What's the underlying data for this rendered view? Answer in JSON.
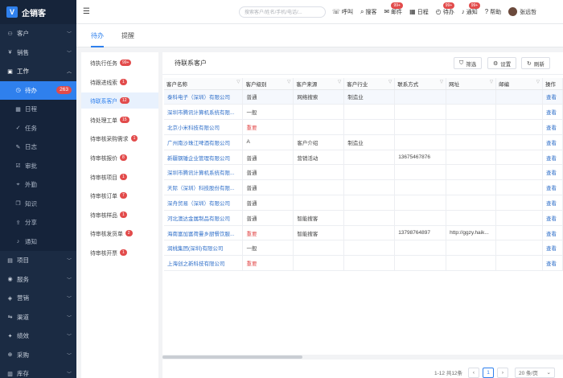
{
  "app": {
    "name": "企销客"
  },
  "sidebar": {
    "groups_top": [
      {
        "label": "客户",
        "icon": "users-icon"
      },
      {
        "label": "销售",
        "icon": "sales-icon"
      }
    ],
    "work_group": {
      "label": "工作",
      "icon": "work-icon"
    },
    "work_items": [
      {
        "label": "待办",
        "icon": "todo-icon",
        "count": "263"
      },
      {
        "label": "日程",
        "icon": "calendar-icon"
      },
      {
        "label": "任务",
        "icon": "task-icon"
      },
      {
        "label": "日志",
        "icon": "log-icon"
      },
      {
        "label": "审批",
        "icon": "approval-icon"
      },
      {
        "label": "外勤",
        "icon": "field-icon"
      },
      {
        "label": "知识",
        "icon": "knowledge-icon"
      },
      {
        "label": "分享",
        "icon": "share-icon"
      },
      {
        "label": "通知",
        "icon": "bell-icon"
      }
    ],
    "groups_bottom": [
      {
        "label": "项目",
        "icon": "project-icon"
      },
      {
        "label": "服务",
        "icon": "service-icon"
      },
      {
        "label": "营销",
        "icon": "marketing-icon"
      },
      {
        "label": "渠道",
        "icon": "channel-icon"
      },
      {
        "label": "绩效",
        "icon": "performance-icon"
      },
      {
        "label": "采购",
        "icon": "purchase-icon"
      },
      {
        "label": "库存",
        "icon": "inventory-icon"
      }
    ]
  },
  "topbar": {
    "search_placeholder": "搜索客户/姓名/手机/电话/...",
    "tools": [
      {
        "label": "呼叫",
        "icon": "phone-icon",
        "badge": ""
      },
      {
        "label": "搜客",
        "icon": "search-customer-icon",
        "badge": ""
      },
      {
        "label": "邮件",
        "icon": "mail-icon",
        "badge": "99+"
      },
      {
        "label": "日程",
        "icon": "calendar-icon",
        "badge": ""
      },
      {
        "label": "待办",
        "icon": "clock-icon",
        "badge": "99+"
      },
      {
        "label": "通知",
        "icon": "bell-icon",
        "badge": "99+"
      },
      {
        "label": "帮助",
        "icon": "help-icon",
        "badge": ""
      }
    ],
    "user_name": "张远哲"
  },
  "tabs": [
    {
      "label": "待办"
    },
    {
      "label": "提醒"
    }
  ],
  "left_list": [
    {
      "label": "待执行任务",
      "badge": "99+"
    },
    {
      "label": "待跟进线索",
      "badge": "1"
    },
    {
      "label": "待联系客户",
      "badge": "12"
    },
    {
      "label": "待处理工单",
      "badge": "15"
    },
    {
      "label": "待审核采购需求",
      "badge": "1"
    },
    {
      "label": "待审核报价",
      "badge": "8"
    },
    {
      "label": "待审核项目",
      "badge": "1"
    },
    {
      "label": "待审核订单",
      "badge": "7"
    },
    {
      "label": "待审核样品",
      "badge": "1"
    },
    {
      "label": "待审核发货单",
      "badge": "2"
    },
    {
      "label": "待审核开票",
      "badge": "1"
    }
  ],
  "main": {
    "title": "待联系客户",
    "buttons": {
      "filter": "筛选",
      "settings": "设置",
      "refresh": "刷新"
    },
    "columns": [
      "客户名称",
      "客户级别",
      "客户来源",
      "客户行业",
      "联系方式",
      "网址",
      "邮编",
      "操作"
    ],
    "rows": [
      [
        "泰科电子（深圳）有限公司",
        "普通",
        "网络搜索",
        "制造业",
        "",
        "",
        "",
        "查看"
      ],
      [
        "深圳市腾讯计算机系统有限...",
        "一般",
        "",
        "",
        "",
        "",
        "",
        "查看"
      ],
      [
        "北京小米科技有限公司",
        "重要",
        "",
        "",
        "",
        "",
        "",
        "查看"
      ],
      [
        "广州南沙珠江啤酒有限公司",
        "A",
        "客户介绍",
        "制造业",
        "",
        "",
        "",
        "查看"
      ],
      [
        "新疆钢锤企业管理有限公司",
        "普通",
        "营销活动",
        "",
        "13675467876",
        "",
        "",
        "查看"
      ],
      [
        "深圳市腾讯计算机系统有限...",
        "普通",
        "",
        "",
        "",
        "",
        "",
        "查看"
      ],
      [
        "天际（深圳）科技股份有限...",
        "普通",
        "",
        "",
        "",
        "",
        "",
        "查看"
      ],
      [
        "深舟贸易（深圳）有限公司",
        "普通",
        "",
        "",
        "",
        "",
        "",
        "查看"
      ],
      [
        "河北澳达金属制品有限公司",
        "普通",
        "智能搜客",
        "",
        "",
        "",
        "",
        "查看"
      ],
      [
        "海南富加富荷曼乡厨餐饮服...",
        "重要",
        "智能搜客",
        "",
        "13798764897",
        "http://ggzy.haik...",
        "",
        "查看"
      ],
      [
        "润桃集团(深圳)有限公司",
        "一般",
        "",
        "",
        "",
        "",
        "",
        "查看"
      ],
      [
        "上海创之新科技有限公司",
        "重要",
        "",
        "",
        "",
        "",
        "",
        "查看"
      ]
    ],
    "level_colors": {
      "重要": "#e24b4b"
    }
  },
  "pagination": {
    "summary": "1-12 共12条",
    "current_page": "1",
    "page_size": "20 条/页"
  },
  "colors": {
    "accent": "#2f80ed",
    "sidebar_bg": "#1b2b43",
    "badge": "#e24b4b"
  }
}
